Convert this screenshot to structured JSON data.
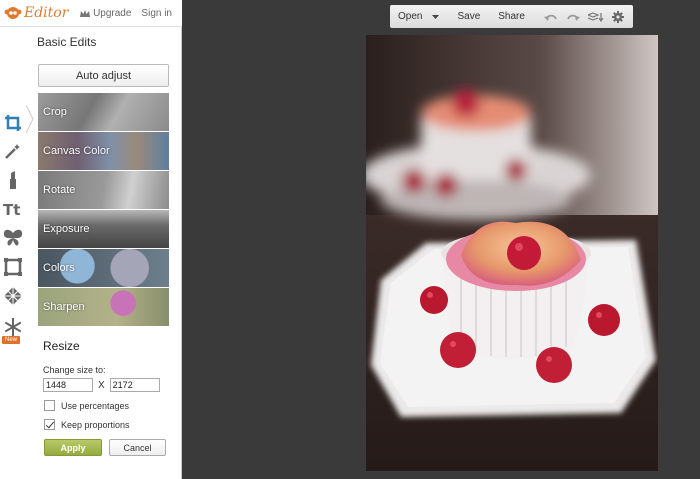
{
  "app": {
    "name": "Editor"
  },
  "header": {
    "upgrade": "Upgrade",
    "sign_in": "Sign in"
  },
  "panel": {
    "title": "Basic Edits",
    "auto_adjust": "Auto adjust",
    "edits": [
      {
        "label": "Crop",
        "color": "#8a8a8a"
      },
      {
        "label": "Canvas Color",
        "color": "#7d7f8e"
      },
      {
        "label": "Rotate",
        "color": "#8b8b8b"
      },
      {
        "label": "Exposure",
        "color": "#7a7a7a"
      },
      {
        "label": "Colors",
        "color": "#6c7a84"
      },
      {
        "label": "Sharpen",
        "color": "#98a080"
      }
    ]
  },
  "resize": {
    "title": "Resize",
    "change_label": "Change size to:",
    "width": "1448",
    "height": "2172",
    "separator": "X",
    "use_percentages": "Use percentages",
    "use_percentages_checked": false,
    "keep_proportions": "Keep proportions",
    "keep_proportions_checked": true,
    "apply": "Apply",
    "cancel": "Cancel"
  },
  "toolbar": {
    "open": "Open",
    "save": "Save",
    "share": "Share"
  },
  "badges": {
    "new": "New"
  },
  "colors": {
    "accent": "#e07a2f",
    "apply": "#a4b84f",
    "canvas_bg": "#3a3a3a"
  }
}
